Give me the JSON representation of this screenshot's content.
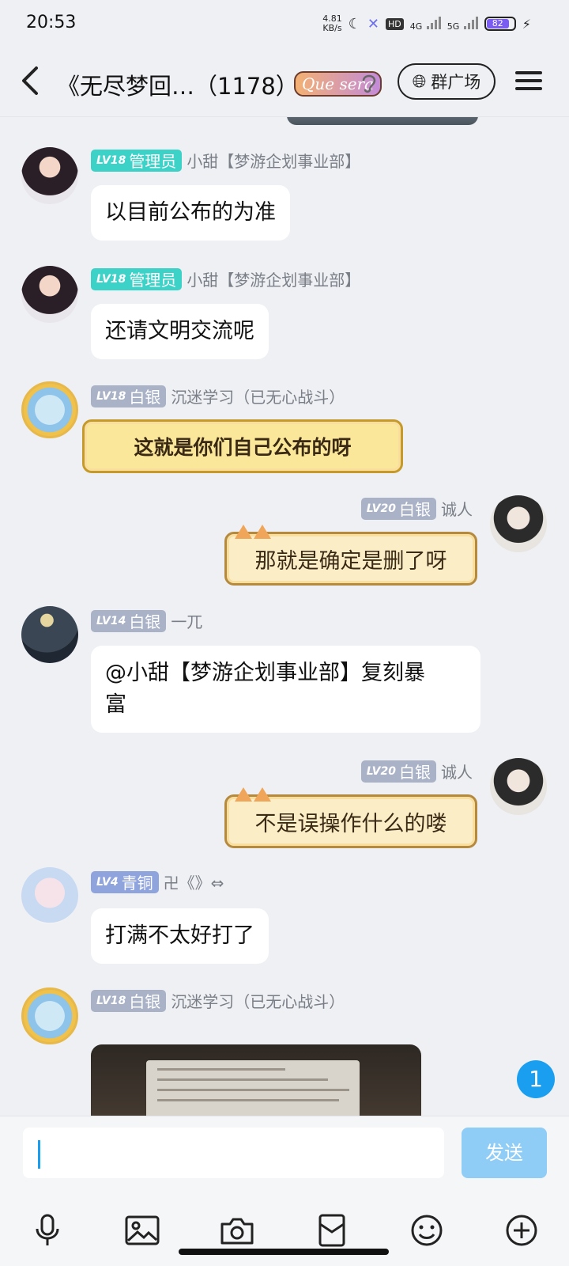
{
  "status_bar": {
    "time": "20:53",
    "net_speed_value": "4.81",
    "net_speed_unit": "KB/s",
    "hd_label": "HD",
    "hd_sub": "1 2",
    "sig1_label": "4G",
    "sig2_label": "5G",
    "battery_level": "82",
    "icons": [
      "moon-icon",
      "mute-icon",
      "bolt-icon"
    ]
  },
  "header": {
    "back_icon": "‹",
    "group_title": "《无尽梦回…（1178）",
    "deco_tag": "Que sera",
    "square_button_label": "群广场"
  },
  "messages": [
    {
      "side": "left",
      "level": "LV18",
      "role": "管理员",
      "sender": "小甜【梦游企划事业部】",
      "text": "以目前公布的为准"
    },
    {
      "side": "left",
      "level": "LV18",
      "role": "管理员",
      "sender": "小甜【梦游企划事业部】",
      "text": "还请文明交流呢"
    },
    {
      "side": "left",
      "level": "LV18",
      "role": "白银",
      "sender": "沉迷学习（已无心战斗）",
      "text": "这就是你们自己公布的呀"
    },
    {
      "side": "right",
      "level": "LV20",
      "role": "白银",
      "sender": "诚人",
      "text": "那就是确定是删了呀"
    },
    {
      "side": "left",
      "level": "LV14",
      "role": "白银",
      "sender": "一兀",
      "text_line1": "@小甜【梦游企划事业部】复刻暴",
      "text_line2": "富"
    },
    {
      "side": "right",
      "level": "LV20",
      "role": "白银",
      "sender": "诚人",
      "text": "不是误操作什么的喽"
    },
    {
      "side": "left",
      "level": "LV4",
      "role": "青铜",
      "sender": "卍《》⇔",
      "text": "打满不太好打了"
    },
    {
      "side": "left",
      "level": "LV18",
      "role": "白银",
      "sender": "沉迷学习（已无心战斗）",
      "type": "image"
    }
  ],
  "unread_count": "1",
  "input": {
    "placeholder": "",
    "value": "",
    "send_label": "发送"
  },
  "toolbar": [
    "microphone-icon",
    "image-icon",
    "camera-icon",
    "red-packet-icon",
    "emoji-icon",
    "plus-icon"
  ],
  "colors": {
    "accent": "#1a9ff0",
    "admin_badge": "#3dd2c8",
    "silver_badge": "#a9b2c6",
    "bronze_badge": "#8fa3dd",
    "send_disabled": "#8fcdf6"
  }
}
